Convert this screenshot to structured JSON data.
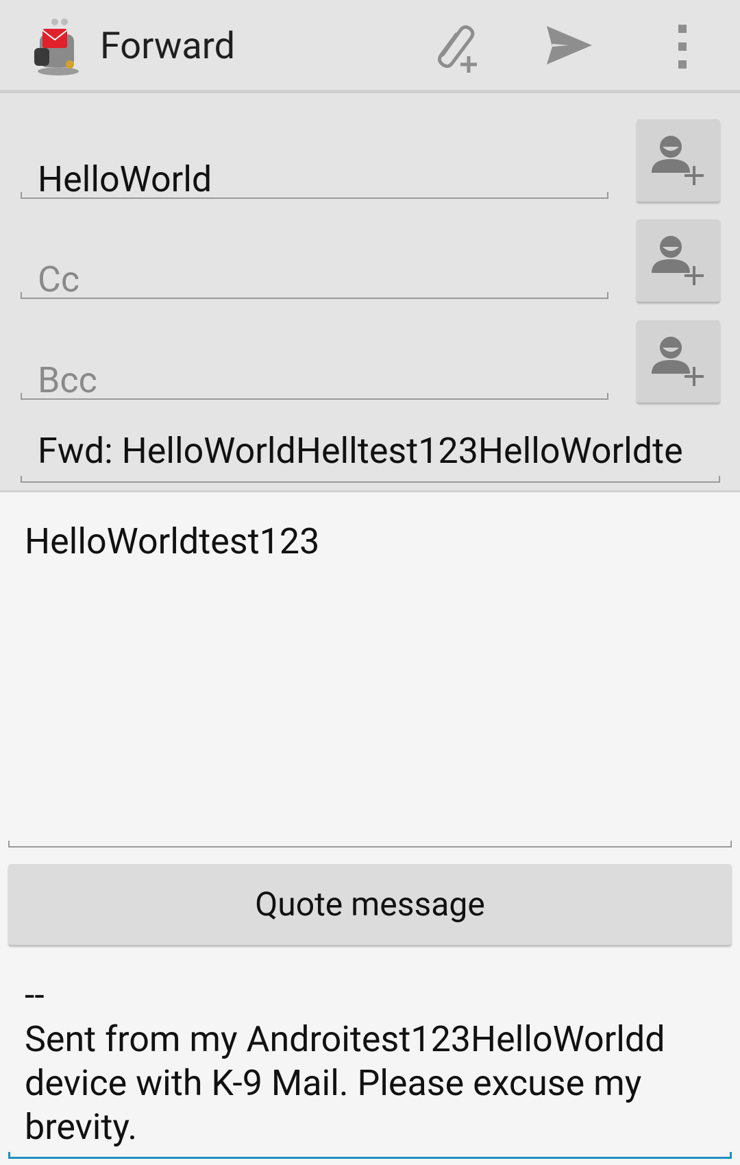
{
  "action_bar": {
    "title": "Forward",
    "icons": [
      "k9-mail-app-icon",
      "attach-icon",
      "send-icon",
      "overflow-menu-icon"
    ]
  },
  "recipients": {
    "to_value": "HelloWorld",
    "cc_placeholder": "Cc",
    "bcc_placeholder": "Bcc"
  },
  "subject": {
    "value": "Fwd: HelloWorldHelltest123HelloWorldte"
  },
  "message": {
    "body": "HelloWorldtest123"
  },
  "quote_button": {
    "label": "Quote message"
  },
  "signature": {
    "text": "--\nSent from my Androitest123HelloWorldd device with K-9 Mail. Please excuse my brevity."
  },
  "colors": {
    "action_bar_bg": "#e4e4e4",
    "focused_underline": "#1e8fbf",
    "app_icon_red": "#e0202a"
  }
}
